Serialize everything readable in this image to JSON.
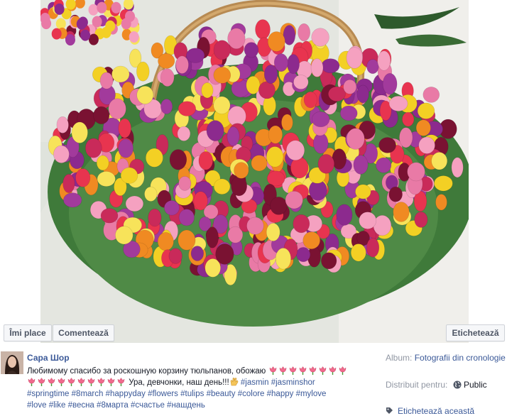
{
  "photo_actions": {
    "like_label": "Îmi place",
    "comment_label": "Comentează",
    "tag_label": "Etichetează"
  },
  "post": {
    "author": "Сара Шор",
    "caption_text_1": "Любимому спасибо за роскошную корзину тюльпанов, обожаю",
    "caption_text_2": "Ура, девчонки, наш день!!!",
    "hashtags_line_1": [
      "#jasmin",
      "#jasminshor"
    ],
    "hashtags_line_2": [
      "#springtime",
      "#8march",
      "#happyday",
      "#flowers",
      "#tulips",
      "#beauty",
      "#colore",
      "#happy",
      "#mylove"
    ],
    "hashtags_line_3": [
      "#love",
      "#like",
      "#весна",
      "#8марта",
      "#счастье",
      "#нашдень"
    ],
    "emoji_row_1_count": 8,
    "emoji_row_2_count": 10,
    "emoji_icon": "tulip-emoji",
    "wave_icon": "waving-hand-icon"
  },
  "side": {
    "album_label": "Album:",
    "album_name": "Fotografii din cronologie",
    "distribution_label": "Distribuit pentru:",
    "privacy_value": "Public",
    "tag_action": "Etichetează această"
  },
  "colors": {
    "link": "#3b5998",
    "button_bg": "#f6f7f9",
    "muted": "#9197a3"
  }
}
